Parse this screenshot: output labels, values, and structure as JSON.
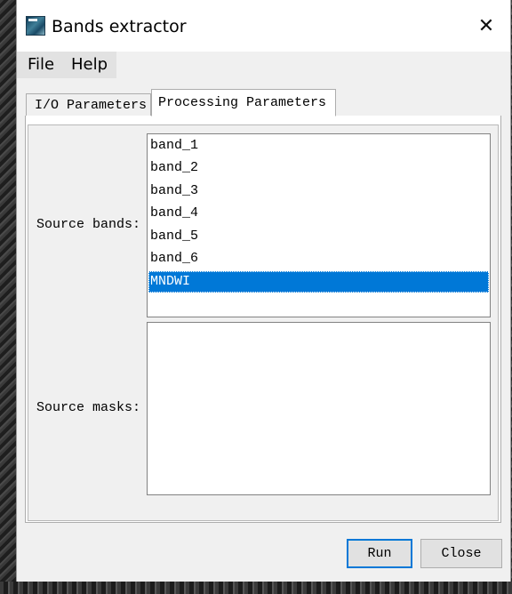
{
  "window": {
    "title": "Bands extractor",
    "app_icon": "snap-app-icon",
    "close_glyph": "✕"
  },
  "menu": {
    "file": "File",
    "help": "Help"
  },
  "tabs": [
    {
      "label": "I/O Parameters",
      "active": false
    },
    {
      "label": "Processing Parameters",
      "active": true
    }
  ],
  "source_bands": {
    "label": "Source bands:",
    "items": [
      "band_1",
      "band_2",
      "band_3",
      "band_4",
      "band_5",
      "band_6",
      "MNDWI"
    ],
    "selected": "MNDWI"
  },
  "source_masks": {
    "label": "Source masks:",
    "items": []
  },
  "buttons": {
    "run": "Run",
    "close": "Close"
  },
  "colors": {
    "selection": "#0078d7",
    "default_button_border": "#0078d7"
  }
}
